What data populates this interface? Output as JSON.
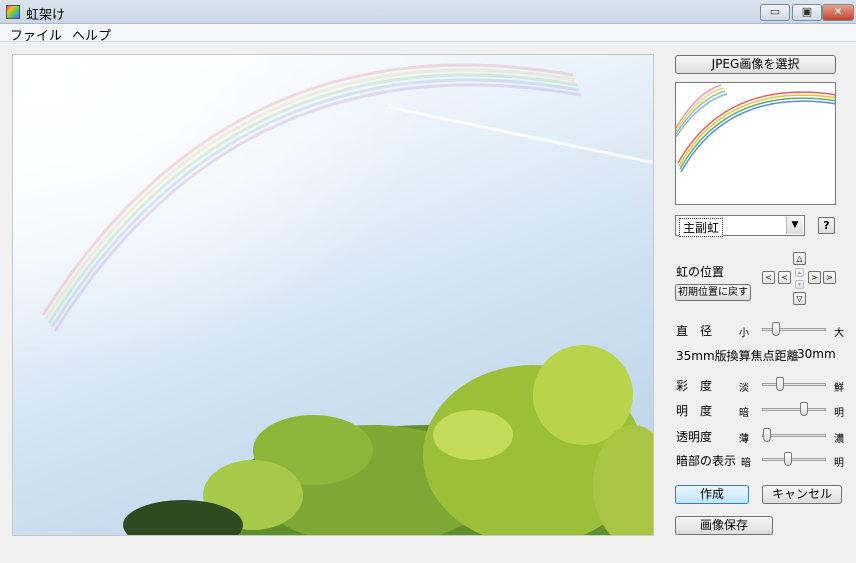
{
  "window": {
    "title": "虹架け",
    "minimize_glyph": "▭",
    "maximize_glyph": "▣",
    "close_glyph": "✕"
  },
  "menu": {
    "file": "ファイル",
    "help": "ヘルプ"
  },
  "panel": {
    "select_jpeg": "JPEG画像を選択",
    "rainbow_type": "主副虹",
    "help_label": "?",
    "rainbow_position": "虹の位置",
    "reset_position": "初期位置に戻す",
    "arrows": {
      "up": "△",
      "down": "▽",
      "left": "<",
      "right": ">",
      "fine_up": "▴",
      "fine_down": "▾"
    },
    "diameter": {
      "label": "直　径",
      "min": "小",
      "max": "大",
      "level": 0.22
    },
    "focal_length": "35mm版換算焦点距離",
    "focal_value": "30mm",
    "saturation": {
      "label": "彩　度",
      "min": "淡",
      "max": "鮮",
      "level": 0.28
    },
    "brightness": {
      "label": "明　度",
      "min": "暗",
      "max": "明",
      "level": 0.66
    },
    "transparency": {
      "label": "透明度",
      "min": "薄",
      "max": "濃",
      "level": 0.08
    },
    "dark_display": {
      "label": "暗部の表示",
      "min": "暗",
      "max": "明",
      "level": 0.4
    },
    "create": "作成",
    "cancel": "キャンセル",
    "save_image": "画像保存"
  }
}
